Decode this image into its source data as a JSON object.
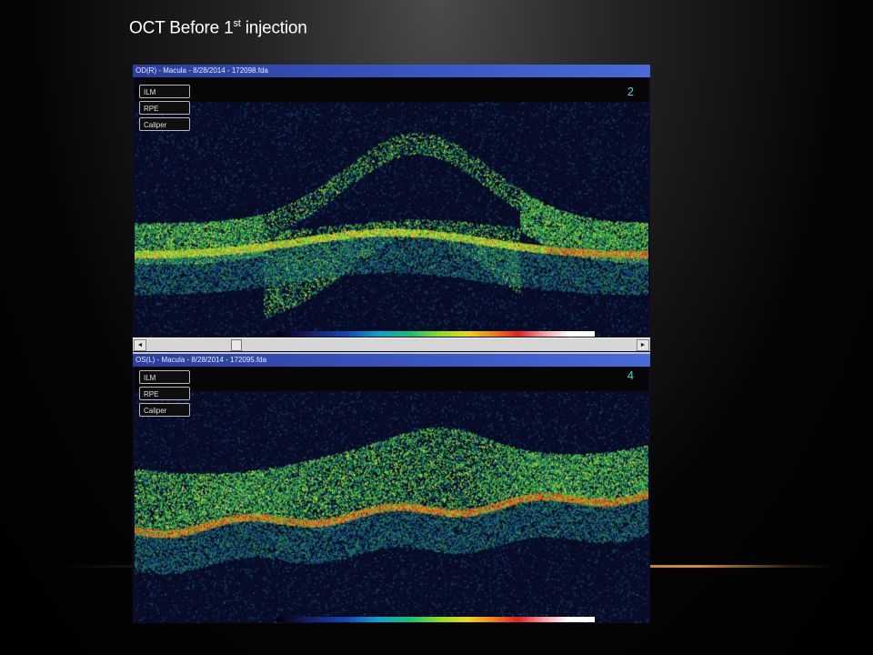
{
  "slide": {
    "title_main": "OCT Before 1",
    "title_sup": "st",
    "title_tail": " injection"
  },
  "od": {
    "window_title": "OD(R) - Macula - 8/28/2014 - 172098.fda",
    "buttons": [
      "ILM",
      "RPE",
      "Caliper"
    ],
    "scan_number": "2"
  },
  "os": {
    "window_title": "OS(L) - Macula - 8/28/2014 - 172095.fda",
    "buttons": [
      "ILM",
      "RPE",
      "Caliper"
    ],
    "scan_number": "4"
  },
  "icons": {
    "scroll_left": "◄",
    "scroll_right": "►"
  },
  "colors": {
    "titlebar": "#3a58c4",
    "scan_background": "#070b24",
    "retina_green": "#3ec030",
    "rpe_red": "#e04020",
    "scan_number": "#3fd4d6"
  }
}
